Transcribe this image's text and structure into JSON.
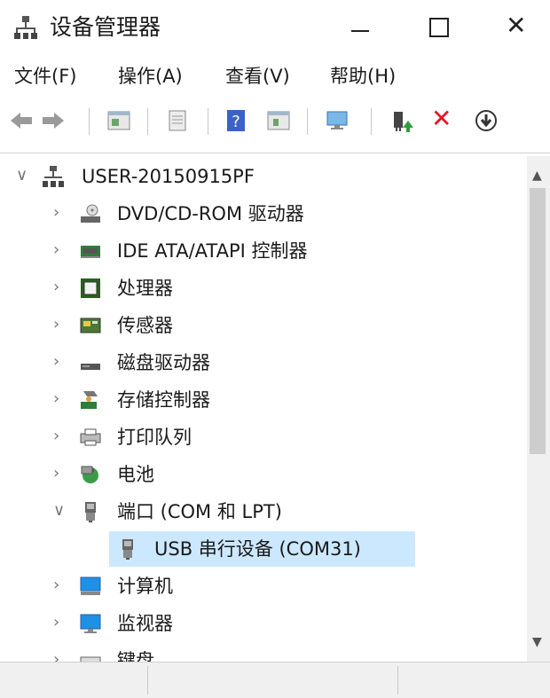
{
  "window": {
    "title": "设备管理器"
  },
  "menu": [
    "文件(F)",
    "操作(A)",
    "查看(V)",
    "帮助(H)"
  ],
  "tree": {
    "root": "USER-20150915PF",
    "items": [
      {
        "label": "DVD/CD-ROM 驱动器",
        "icon": "disc-drive-icon",
        "expanded": false
      },
      {
        "label": "IDE ATA/ATAPI 控制器",
        "icon": "ide-controller-icon",
        "expanded": false
      },
      {
        "label": "处理器",
        "icon": "processor-icon",
        "expanded": false
      },
      {
        "label": "传感器",
        "icon": "sensor-icon",
        "expanded": false
      },
      {
        "label": "磁盘驱动器",
        "icon": "disk-drive-icon",
        "expanded": false
      },
      {
        "label": "存储控制器",
        "icon": "storage-controller-icon",
        "expanded": false
      },
      {
        "label": "打印队列",
        "icon": "printer-icon",
        "expanded": false
      },
      {
        "label": "电池",
        "icon": "battery-icon",
        "expanded": false
      },
      {
        "label": "端口 (COM 和 LPT)",
        "icon": "port-icon",
        "expanded": true
      },
      {
        "label": "USB 串行设备 (COM31)",
        "icon": "port-icon",
        "child": true,
        "selected": true
      },
      {
        "label": "计算机",
        "icon": "computer-icon",
        "expanded": false
      },
      {
        "label": "监视器",
        "icon": "monitor-icon",
        "expanded": false
      },
      {
        "label": "键盘",
        "icon": "keyboard-icon",
        "expanded": false
      }
    ]
  },
  "colors": {
    "selection": "#cce8ff",
    "delete_red": "#e81123",
    "update_green": "#2e9e3e"
  }
}
